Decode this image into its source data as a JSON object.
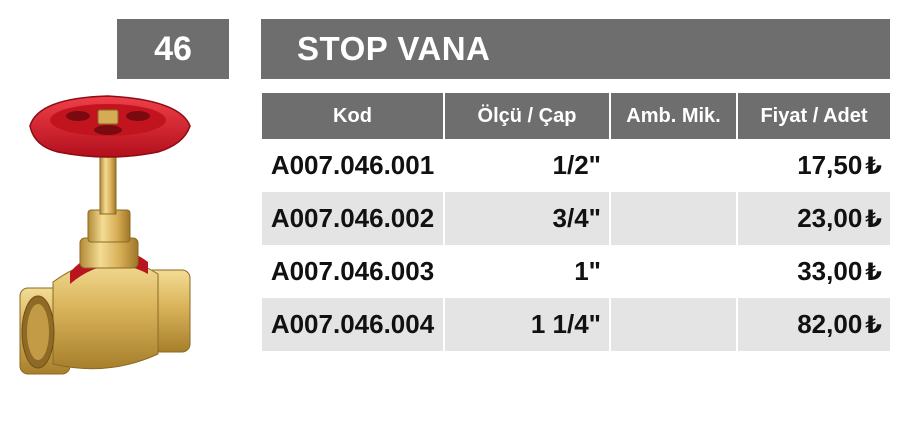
{
  "page_number": "46",
  "title": "STOP VANA",
  "table": {
    "headers": {
      "code": "Kod",
      "size": "Ölçü / Çap",
      "pack": "Amb. Mik.",
      "price": "Fiyat / Adet"
    },
    "rows": [
      {
        "code": "A007.046.001",
        "size": "1/2\"",
        "pack": "",
        "price": "17,50"
      },
      {
        "code": "A007.046.002",
        "size": "3/4\"",
        "pack": "",
        "price": "23,00"
      },
      {
        "code": "A007.046.003",
        "size": "1\"",
        "pack": "",
        "price": "33,00"
      },
      {
        "code": "A007.046.004",
        "size": "1 1/4\"",
        "pack": "",
        "price": "82,00"
      }
    ],
    "currency_symbol": "₺"
  },
  "colors": {
    "header_bg": "#6e6e6e",
    "row_shade": "#e4e4e4",
    "handwheel": "#d8182a",
    "brass": "#d9b35a"
  },
  "image": {
    "icon": "gate-valve-icon"
  }
}
